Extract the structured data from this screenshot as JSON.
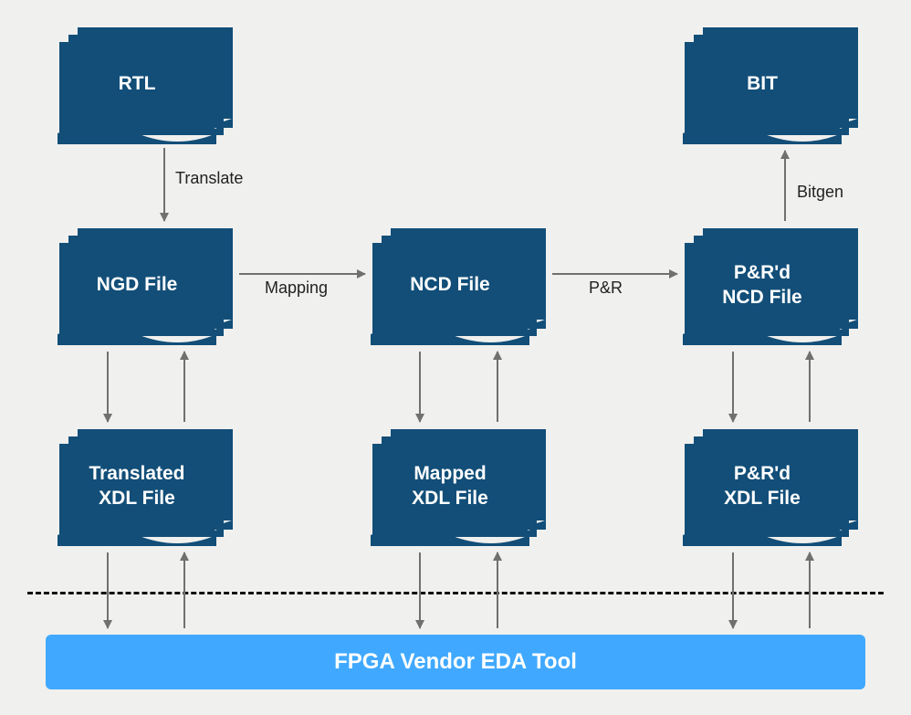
{
  "nodes": {
    "rtl": "RTL",
    "bit": "BIT",
    "ngd": "NGD File",
    "ncd": "NCD File",
    "pr_ncd": "P&R'd\nNCD File",
    "translated_xdl": "Translated\nXDL File",
    "mapped_xdl": "Mapped\nXDL File",
    "pr_xdl": "P&R'd\nXDL File"
  },
  "edges": {
    "translate": "Translate",
    "mapping": "Mapping",
    "pr": "P&R",
    "bitgen": "Bitgen"
  },
  "eda": "FPGA Vendor EDA Tool"
}
